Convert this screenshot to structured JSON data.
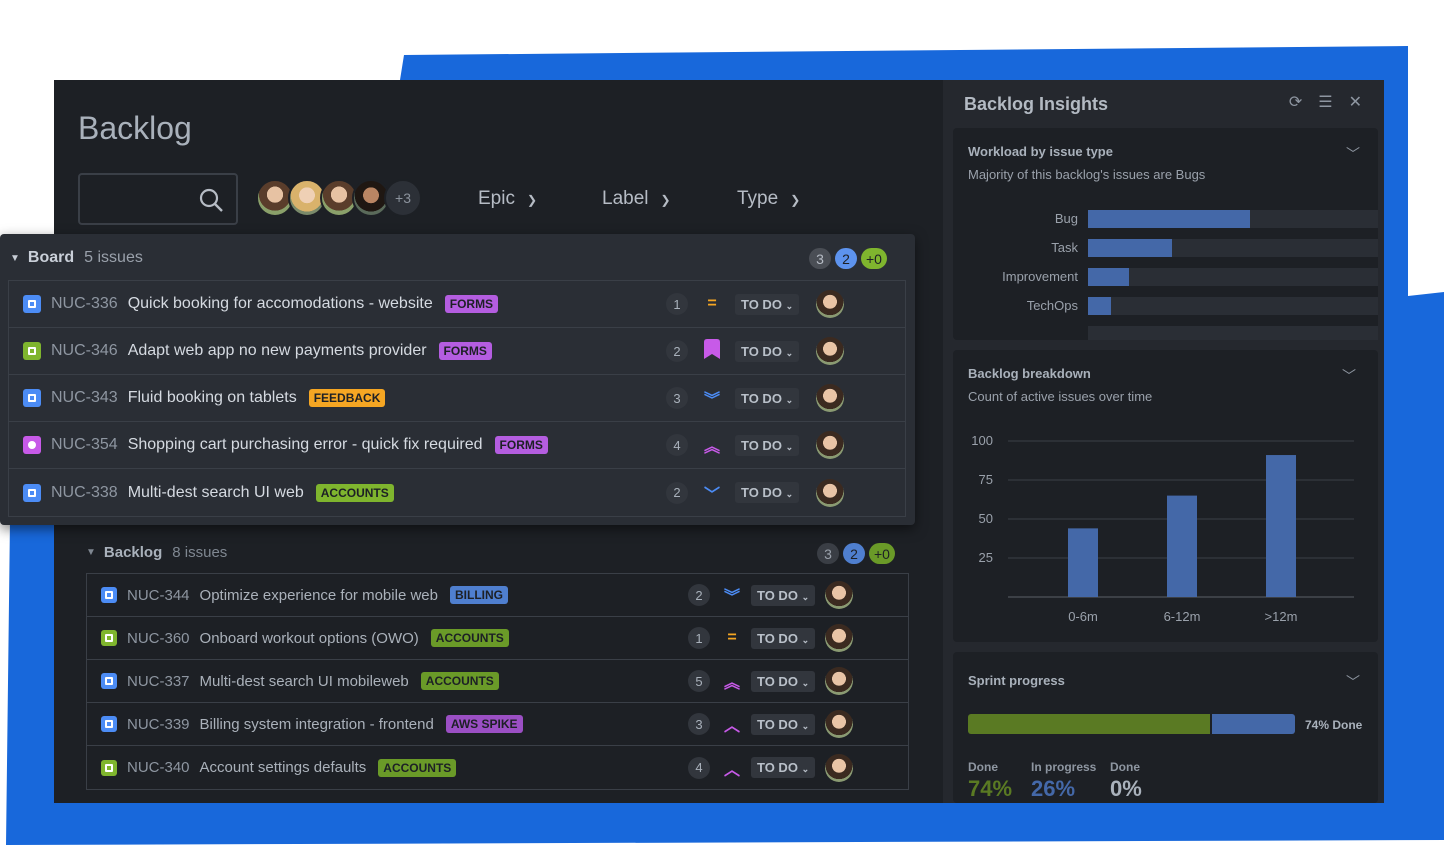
{
  "colors": {
    "brand_blue": "#1868db",
    "bg_dark": "#1d2025",
    "done_green": "#5a7a23",
    "progress_blue": "#4468a8"
  },
  "main": {
    "title": "Backlog",
    "search": {
      "placeholder": "",
      "icon": "search-icon"
    },
    "avatars_more": "+3",
    "filters": [
      {
        "label": "Epic"
      },
      {
        "label": "Label"
      },
      {
        "label": "Type"
      }
    ]
  },
  "board": {
    "name": "Board",
    "count": "5 issues",
    "badges": [
      "3",
      "2",
      "+0"
    ],
    "rows": [
      {
        "type": "task",
        "key": "NUC-336",
        "summary": "Quick booking for accomodations - website",
        "label": "FORMS",
        "label_color": "#b45de0",
        "estimate": "1",
        "priority": "medium",
        "status": "TO DO"
      },
      {
        "type": "story",
        "key": "NUC-346",
        "summary": "Adapt web app no new payments provider",
        "label": "FORMS",
        "label_color": "#b45de0",
        "estimate": "2",
        "priority": "bookmark",
        "status": "TO DO"
      },
      {
        "type": "task",
        "key": "NUC-343",
        "summary": "Fluid booking on tablets",
        "label": "FEEDBACK",
        "label_color": "#f5a623",
        "estimate": "3",
        "priority": "lowest",
        "status": "TO DO"
      },
      {
        "type": "bug",
        "key": "NUC-354",
        "summary": "Shopping cart purchasing error - quick fix required",
        "label": "FORMS",
        "label_color": "#b45de0",
        "estimate": "4",
        "priority": "highest",
        "status": "TO DO"
      },
      {
        "type": "task",
        "key": "NUC-338",
        "summary": "Multi-dest search UI web",
        "label": "ACCOUNTS",
        "label_color": "#7fb52e",
        "estimate": "2",
        "priority": "low",
        "status": "TO DO"
      }
    ]
  },
  "backlog": {
    "name": "Backlog",
    "count": "8 issues",
    "badges": [
      "3",
      "2",
      "+0"
    ],
    "rows": [
      {
        "type": "task",
        "key": "NUC-344",
        "summary": "Optimize experience for mobile web",
        "label": "BILLING",
        "label_color": "#4f7fcf",
        "estimate": "2",
        "priority": "lowest",
        "status": "TO DO"
      },
      {
        "type": "story",
        "key": "NUC-360",
        "summary": "Onboard workout options (OWO)",
        "label": "ACCOUNTS",
        "label_color": "#6a9a28",
        "estimate": "1",
        "priority": "medium",
        "status": "TO DO"
      },
      {
        "type": "task",
        "key": "NUC-337",
        "summary": "Multi-dest search UI mobileweb",
        "label": "ACCOUNTS",
        "label_color": "#6a9a28",
        "estimate": "5",
        "priority": "highest",
        "status": "TO DO"
      },
      {
        "type": "task",
        "key": "NUC-339",
        "summary": "Billing system integration - frontend",
        "label": "AWS SPIKE",
        "label_color": "#9b4fc4",
        "estimate": "3",
        "priority": "high",
        "status": "TO DO"
      },
      {
        "type": "story",
        "key": "NUC-340",
        "summary": "Account settings defaults",
        "label": "ACCOUNTS",
        "label_color": "#6a9a28",
        "estimate": "4",
        "priority": "high",
        "status": "TO DO"
      }
    ]
  },
  "insights": {
    "title": "Backlog Insights",
    "icons": [
      "refresh-icon",
      "settings-sliders-icon",
      "close-icon"
    ],
    "workload": {
      "title": "Workload by issue type",
      "subtitle": "Majority of this backlog's issues are Bugs"
    },
    "breakdown": {
      "title": "Backlog breakdown",
      "subtitle": "Count of active issues over time"
    },
    "sprint": {
      "title": "Sprint progress",
      "done_fraction": 0.74,
      "progress_label": "74% Done",
      "stats": [
        {
          "label": "Done",
          "value": "74%",
          "color": "#5a7a23"
        },
        {
          "label": "In progress",
          "value": "26%",
          "color": "#4468a8"
        },
        {
          "label": "Done",
          "value": "0%",
          "color": "#a9b1bb"
        }
      ]
    }
  },
  "chart_data": [
    {
      "type": "bar",
      "orientation": "horizontal",
      "title": "Workload by issue type",
      "categories": [
        "Bug",
        "Task",
        "Improvement",
        "TechOps"
      ],
      "values": [
        0.56,
        0.29,
        0.14,
        0.08
      ],
      "xlim": [
        0,
        1
      ]
    },
    {
      "type": "bar",
      "title": "Backlog breakdown",
      "categories": [
        "0-6m",
        "6-12m",
        ">12m"
      ],
      "values": [
        44,
        65,
        91
      ],
      "ylim": [
        0,
        100
      ],
      "yticks": [
        25,
        50,
        75,
        100
      ],
      "grid": true
    }
  ]
}
